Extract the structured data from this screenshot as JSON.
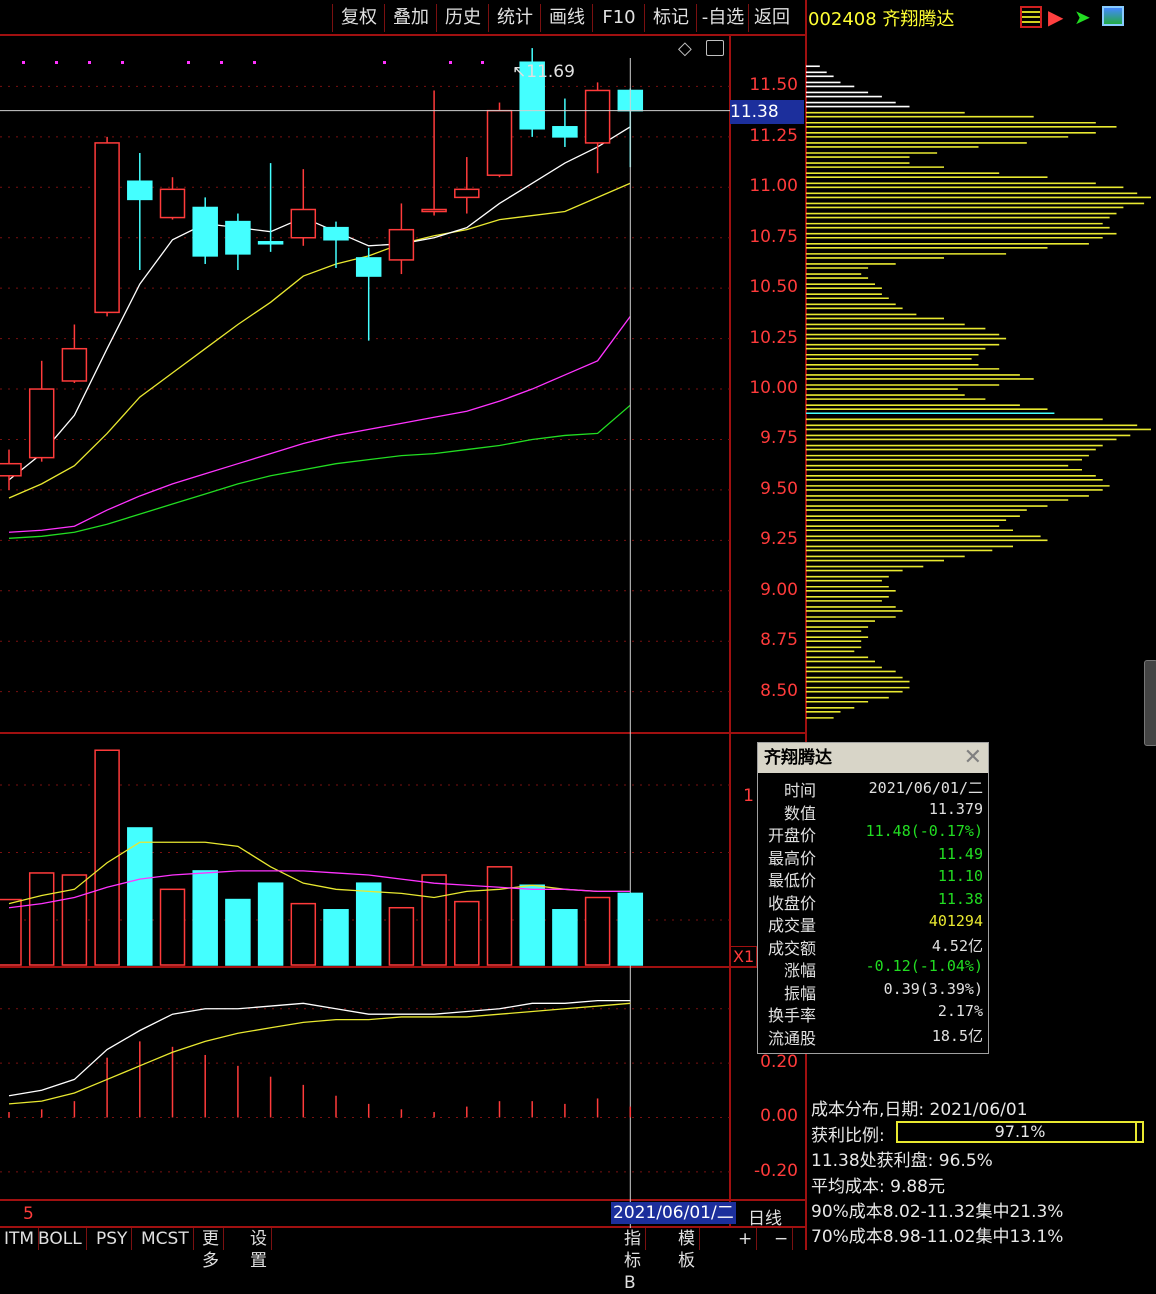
{
  "toolbar": {
    "buttons": [
      {
        "label": "复权"
      },
      {
        "label": "叠加"
      },
      {
        "label": "历史"
      },
      {
        "label": "统计"
      },
      {
        "label": "画线"
      },
      {
        "label": "F10"
      },
      {
        "label": "标记"
      },
      {
        "label": "-自选"
      },
      {
        "label": "返回"
      }
    ]
  },
  "stock": {
    "code_name": "002408 齐翔腾达"
  },
  "price_axis": {
    "ticks": [
      "11.50",
      "11.25",
      "11.00",
      "10.75",
      "10.50",
      "10.25",
      "10.00",
      "9.75",
      "9.50",
      "9.25",
      "9.00",
      "8.75",
      "8.50"
    ],
    "current_price_badge": "11.38",
    "high_marker": "11.69"
  },
  "volume_axis": {
    "tick": "1",
    "multiplier": "X1"
  },
  "macd_axis": {
    "ticks": [
      "0.20",
      "0.00",
      "-0.20"
    ]
  },
  "popup": {
    "title": "齐翔腾达",
    "rows": [
      {
        "key": "时间",
        "value": "2021/06/01/二",
        "color": "#e0e0e0"
      },
      {
        "key": "数值",
        "value": "11.379",
        "color": "#e0e0e0"
      },
      {
        "key": "开盘价",
        "value": "11.48(-0.17%)",
        "color": "#22dd22"
      },
      {
        "key": "最高价",
        "value": "11.49",
        "color": "#22dd22"
      },
      {
        "key": "最低价",
        "value": "11.10",
        "color": "#22dd22"
      },
      {
        "key": "收盘价",
        "value": "11.38",
        "color": "#22dd22"
      },
      {
        "key": "成交量",
        "value": "401294",
        "color": "#e8e830"
      },
      {
        "key": "成交额",
        "value": "4.52亿",
        "color": "#e0e0e0"
      },
      {
        "key": "涨幅",
        "value": "-0.12(-1.04%)",
        "color": "#22dd22"
      },
      {
        "key": "振幅",
        "value": "0.39(3.39%)",
        "color": "#e0e0e0"
      },
      {
        "key": "换手率",
        "value": "2.17%",
        "color": "#e0e0e0"
      },
      {
        "key": "流通股",
        "value": "18.5亿",
        "color": "#e0e0e0"
      }
    ]
  },
  "cost": {
    "date_line": "成本分布,日期: 2021/06/01",
    "profit_label": "获利比例:",
    "profit_value": "97.1%",
    "profit_fraction": 0.971,
    "at_price_line": "11.38处获利盘: 96.5%",
    "avg_line": "平均成本: 9.88元",
    "p90_line": "90%成本8.02-11.32集中21.3%",
    "p70_line": "70%成本8.98-11.02集中13.1%"
  },
  "date_axis": {
    "left_mark": "5",
    "cursor_date": "2021/06/01/二",
    "period": "日线"
  },
  "bottom_tabs": [
    "ITM",
    "BOLL",
    "PSY",
    "MCST",
    "更多",
    "设置"
  ],
  "bottom_right": [
    "指标B",
    "模 板",
    "+",
    "−"
  ],
  "colors": {
    "up": "#ff3b3b",
    "down": "#44ffff",
    "ma5": "#ffffff",
    "ma10": "#e8e830",
    "ma20": "#ff33ff",
    "ma60": "#22dd22",
    "border": "#a01010"
  },
  "chart_data": {
    "type": "candlestick",
    "price_ylim": [
      8.3,
      11.75
    ],
    "candles": [
      {
        "o": 9.57,
        "h": 9.7,
        "l": 9.5,
        "c": 9.63
      },
      {
        "o": 9.66,
        "h": 10.14,
        "l": 9.64,
        "c": 10.0
      },
      {
        "o": 10.04,
        "h": 10.32,
        "l": 10.03,
        "c": 10.2
      },
      {
        "o": 10.38,
        "h": 11.25,
        "l": 10.36,
        "c": 11.22
      },
      {
        "o": 11.03,
        "h": 11.17,
        "l": 10.59,
        "c": 10.94
      },
      {
        "o": 10.85,
        "h": 11.05,
        "l": 10.84,
        "c": 10.99
      },
      {
        "o": 10.9,
        "h": 10.95,
        "l": 10.62,
        "c": 10.66
      },
      {
        "o": 10.83,
        "h": 10.87,
        "l": 10.59,
        "c": 10.67
      },
      {
        "o": 10.73,
        "h": 11.12,
        "l": 10.68,
        "c": 10.72
      },
      {
        "o": 10.75,
        "h": 11.09,
        "l": 10.71,
        "c": 10.89
      },
      {
        "o": 10.8,
        "h": 10.83,
        "l": 10.6,
        "c": 10.74
      },
      {
        "o": 10.65,
        "h": 10.7,
        "l": 10.24,
        "c": 10.56
      },
      {
        "o": 10.64,
        "h": 10.92,
        "l": 10.57,
        "c": 10.79
      },
      {
        "o": 10.88,
        "h": 11.48,
        "l": 10.86,
        "c": 10.89
      },
      {
        "o": 10.95,
        "h": 11.15,
        "l": 10.87,
        "c": 10.99
      },
      {
        "o": 11.06,
        "h": 11.42,
        "l": 11.05,
        "c": 11.38
      },
      {
        "o": 11.62,
        "h": 11.69,
        "l": 11.25,
        "c": 11.29
      },
      {
        "o": 11.3,
        "h": 11.44,
        "l": 11.2,
        "c": 11.25
      },
      {
        "o": 11.22,
        "h": 11.52,
        "l": 11.07,
        "c": 11.48
      },
      {
        "o": 11.48,
        "h": 11.49,
        "l": 11.1,
        "c": 11.38
      }
    ],
    "ma5": [
      9.55,
      9.68,
      9.87,
      10.2,
      10.52,
      10.74,
      10.82,
      10.8,
      10.78,
      10.85,
      10.78,
      10.71,
      10.72,
      10.75,
      10.8,
      10.92,
      11.02,
      11.12,
      11.2,
      11.3
    ],
    "ma10": [
      9.46,
      9.53,
      9.62,
      9.78,
      9.96,
      10.08,
      10.2,
      10.32,
      10.43,
      10.56,
      10.62,
      10.66,
      10.72,
      10.76,
      10.79,
      10.84,
      10.86,
      10.88,
      10.95,
      11.02
    ],
    "ma20": [
      9.29,
      9.3,
      9.32,
      9.4,
      9.47,
      9.53,
      9.58,
      9.63,
      9.68,
      9.73,
      9.77,
      9.8,
      9.83,
      9.86,
      9.89,
      9.94,
      10.0,
      10.07,
      10.14,
      10.36
    ],
    "ma60": [
      9.26,
      9.27,
      9.29,
      9.33,
      9.38,
      9.43,
      9.48,
      9.53,
      9.57,
      9.6,
      9.63,
      9.65,
      9.67,
      9.68,
      9.7,
      9.72,
      9.75,
      9.77,
      9.78,
      9.92
    ],
    "volume": [
      0.32,
      0.45,
      0.44,
      1.05,
      0.67,
      0.37,
      0.46,
      0.32,
      0.4,
      0.3,
      0.27,
      0.4,
      0.28,
      0.44,
      0.31,
      0.48,
      0.39,
      0.27,
      0.33,
      0.35
    ],
    "vol_ma1": [
      0.3,
      0.34,
      0.37,
      0.5,
      0.6,
      0.6,
      0.6,
      0.58,
      0.48,
      0.4,
      0.37,
      0.36,
      0.35,
      0.33,
      0.36,
      0.37,
      0.39,
      0.37,
      0.36,
      0.36
    ],
    "vol_ma2": [
      0.28,
      0.3,
      0.33,
      0.38,
      0.42,
      0.44,
      0.45,
      0.46,
      0.46,
      0.46,
      0.45,
      0.44,
      0.42,
      0.4,
      0.39,
      0.38,
      0.37,
      0.37,
      0.36,
      0.36
    ],
    "macd_ylim": [
      -0.3,
      0.55
    ],
    "macd_dif": [
      0.08,
      0.1,
      0.14,
      0.25,
      0.32,
      0.38,
      0.4,
      0.4,
      0.41,
      0.42,
      0.4,
      0.38,
      0.38,
      0.38,
      0.39,
      0.4,
      0.42,
      0.42,
      0.43,
      0.43
    ],
    "macd_dea": [
      0.05,
      0.06,
      0.09,
      0.14,
      0.19,
      0.24,
      0.28,
      0.31,
      0.33,
      0.35,
      0.36,
      0.36,
      0.37,
      0.37,
      0.37,
      0.38,
      0.39,
      0.4,
      0.41,
      0.42
    ],
    "macd_hist": [
      0.02,
      0.03,
      0.06,
      0.22,
      0.28,
      0.26,
      0.23,
      0.19,
      0.15,
      0.12,
      0.08,
      0.05,
      0.03,
      0.02,
      0.04,
      0.06,
      0.06,
      0.05,
      0.07,
      0.04
    ],
    "profile": [
      {
        "p": 11.6,
        "w": 0.04,
        "c": "#ffffff"
      },
      {
        "p": 11.57,
        "w": 0.06,
        "c": "#ffffff"
      },
      {
        "p": 11.55,
        "w": 0.08,
        "c": "#ffffff"
      },
      {
        "p": 11.52,
        "w": 0.1,
        "c": "#ffffff"
      },
      {
        "p": 11.5,
        "w": 0.14,
        "c": "#ffffff"
      },
      {
        "p": 11.47,
        "w": 0.18,
        "c": "#ffffff"
      },
      {
        "p": 11.45,
        "w": 0.22,
        "c": "#ffffff"
      },
      {
        "p": 11.42,
        "w": 0.26,
        "c": "#ffffff"
      },
      {
        "p": 11.4,
        "w": 0.3,
        "c": "#ffffff"
      },
      {
        "p": 11.37,
        "w": 0.46,
        "c": "#e8e830"
      },
      {
        "p": 11.35,
        "w": 0.66,
        "c": "#e8e830"
      },
      {
        "p": 11.32,
        "w": 0.84,
        "c": "#e8e830"
      },
      {
        "p": 11.3,
        "w": 0.9,
        "c": "#e8e830"
      },
      {
        "p": 11.27,
        "w": 0.84,
        "c": "#e8e830"
      },
      {
        "p": 11.25,
        "w": 0.76,
        "c": "#e8e830"
      },
      {
        "p": 11.22,
        "w": 0.64,
        "c": "#e8e830"
      },
      {
        "p": 11.2,
        "w": 0.5,
        "c": "#e8e830"
      },
      {
        "p": 11.17,
        "w": 0.38,
        "c": "#e8e830"
      },
      {
        "p": 11.15,
        "w": 0.3,
        "c": "#e8e830"
      },
      {
        "p": 11.12,
        "w": 0.3,
        "c": "#e8e830"
      },
      {
        "p": 11.1,
        "w": 0.4,
        "c": "#e8e830"
      },
      {
        "p": 11.07,
        "w": 0.56,
        "c": "#e8e830"
      },
      {
        "p": 11.05,
        "w": 0.7,
        "c": "#e8e830"
      },
      {
        "p": 11.02,
        "w": 0.84,
        "c": "#e8e830"
      },
      {
        "p": 11.0,
        "w": 0.92,
        "c": "#e8e830"
      },
      {
        "p": 10.97,
        "w": 0.96,
        "c": "#e8e830"
      },
      {
        "p": 10.95,
        "w": 1.0,
        "c": "#e8e830"
      },
      {
        "p": 10.92,
        "w": 0.98,
        "c": "#e8e830"
      },
      {
        "p": 10.9,
        "w": 0.92,
        "c": "#e8e830"
      },
      {
        "p": 10.87,
        "w": 0.9,
        "c": "#e8e830"
      },
      {
        "p": 10.85,
        "w": 0.88,
        "c": "#e8e830"
      },
      {
        "p": 10.82,
        "w": 0.86,
        "c": "#e8e830"
      },
      {
        "p": 10.8,
        "w": 0.88,
        "c": "#e8e830"
      },
      {
        "p": 10.77,
        "w": 0.9,
        "c": "#e8e830"
      },
      {
        "p": 10.75,
        "w": 0.86,
        "c": "#e8e830"
      },
      {
        "p": 10.72,
        "w": 0.82,
        "c": "#e8e830"
      },
      {
        "p": 10.7,
        "w": 0.7,
        "c": "#e8e830"
      },
      {
        "p": 10.67,
        "w": 0.58,
        "c": "#e8e830"
      },
      {
        "p": 10.65,
        "w": 0.4,
        "c": "#e8e830"
      },
      {
        "p": 10.62,
        "w": 0.26,
        "c": "#e8e830"
      },
      {
        "p": 10.6,
        "w": 0.18,
        "c": "#e8e830"
      },
      {
        "p": 10.57,
        "w": 0.16,
        "c": "#e8e830"
      },
      {
        "p": 10.55,
        "w": 0.18,
        "c": "#e8e830"
      },
      {
        "p": 10.52,
        "w": 0.2,
        "c": "#e8e830"
      },
      {
        "p": 10.5,
        "w": 0.22,
        "c": "#e8e830"
      },
      {
        "p": 10.47,
        "w": 0.22,
        "c": "#e8e830"
      },
      {
        "p": 10.45,
        "w": 0.24,
        "c": "#e8e830"
      },
      {
        "p": 10.42,
        "w": 0.26,
        "c": "#e8e830"
      },
      {
        "p": 10.4,
        "w": 0.28,
        "c": "#e8e830"
      },
      {
        "p": 10.37,
        "w": 0.32,
        "c": "#e8e830"
      },
      {
        "p": 10.35,
        "w": 0.4,
        "c": "#e8e830"
      },
      {
        "p": 10.32,
        "w": 0.46,
        "c": "#e8e830"
      },
      {
        "p": 10.3,
        "w": 0.52,
        "c": "#e8e830"
      },
      {
        "p": 10.27,
        "w": 0.56,
        "c": "#e8e830"
      },
      {
        "p": 10.25,
        "w": 0.58,
        "c": "#e8e830"
      },
      {
        "p": 10.22,
        "w": 0.56,
        "c": "#e8e830"
      },
      {
        "p": 10.2,
        "w": 0.52,
        "c": "#e8e830"
      },
      {
        "p": 10.17,
        "w": 0.5,
        "c": "#e8e830"
      },
      {
        "p": 10.15,
        "w": 0.48,
        "c": "#e8e830"
      },
      {
        "p": 10.12,
        "w": 0.5,
        "c": "#e8e830"
      },
      {
        "p": 10.1,
        "w": 0.56,
        "c": "#e8e830"
      },
      {
        "p": 10.07,
        "w": 0.62,
        "c": "#e8e830"
      },
      {
        "p": 10.05,
        "w": 0.66,
        "c": "#e8e830"
      },
      {
        "p": 10.02,
        "w": 0.56,
        "c": "#e8e830"
      },
      {
        "p": 10.0,
        "w": 0.44,
        "c": "#e8e830"
      },
      {
        "p": 9.97,
        "w": 0.46,
        "c": "#e8e830"
      },
      {
        "p": 9.95,
        "w": 0.52,
        "c": "#e8e830"
      },
      {
        "p": 9.92,
        "w": 0.62,
        "c": "#e8e830"
      },
      {
        "p": 9.9,
        "w": 0.7,
        "c": "#e8e830"
      },
      {
        "p": 9.88,
        "w": 0.72,
        "c": "#44ffff"
      },
      {
        "p": 9.85,
        "w": 0.86,
        "c": "#e8e830"
      },
      {
        "p": 9.82,
        "w": 0.96,
        "c": "#e8e830"
      },
      {
        "p": 9.8,
        "w": 1.0,
        "c": "#e8e830"
      },
      {
        "p": 9.77,
        "w": 0.94,
        "c": "#e8e830"
      },
      {
        "p": 9.75,
        "w": 0.9,
        "c": "#e8e830"
      },
      {
        "p": 9.72,
        "w": 0.86,
        "c": "#e8e830"
      },
      {
        "p": 9.7,
        "w": 0.84,
        "c": "#e8e830"
      },
      {
        "p": 9.67,
        "w": 0.82,
        "c": "#e8e830"
      },
      {
        "p": 9.65,
        "w": 0.8,
        "c": "#e8e830"
      },
      {
        "p": 9.62,
        "w": 0.76,
        "c": "#e8e830"
      },
      {
        "p": 9.6,
        "w": 0.8,
        "c": "#e8e830"
      },
      {
        "p": 9.57,
        "w": 0.84,
        "c": "#e8e830"
      },
      {
        "p": 9.55,
        "w": 0.86,
        "c": "#e8e830"
      },
      {
        "p": 9.52,
        "w": 0.88,
        "c": "#e8e830"
      },
      {
        "p": 9.5,
        "w": 0.86,
        "c": "#e8e830"
      },
      {
        "p": 9.47,
        "w": 0.82,
        "c": "#e8e830"
      },
      {
        "p": 9.45,
        "w": 0.76,
        "c": "#e8e830"
      },
      {
        "p": 9.42,
        "w": 0.7,
        "c": "#e8e830"
      },
      {
        "p": 9.4,
        "w": 0.64,
        "c": "#e8e830"
      },
      {
        "p": 9.37,
        "w": 0.62,
        "c": "#e8e830"
      },
      {
        "p": 9.35,
        "w": 0.58,
        "c": "#e8e830"
      },
      {
        "p": 9.32,
        "w": 0.56,
        "c": "#e8e830"
      },
      {
        "p": 9.3,
        "w": 0.6,
        "c": "#e8e830"
      },
      {
        "p": 9.27,
        "w": 0.68,
        "c": "#e8e830"
      },
      {
        "p": 9.25,
        "w": 0.7,
        "c": "#e8e830"
      },
      {
        "p": 9.22,
        "w": 0.6,
        "c": "#e8e830"
      },
      {
        "p": 9.2,
        "w": 0.54,
        "c": "#e8e830"
      },
      {
        "p": 9.17,
        "w": 0.46,
        "c": "#e8e830"
      },
      {
        "p": 9.15,
        "w": 0.4,
        "c": "#e8e830"
      },
      {
        "p": 9.12,
        "w": 0.34,
        "c": "#e8e830"
      },
      {
        "p": 9.1,
        "w": 0.28,
        "c": "#e8e830"
      },
      {
        "p": 9.07,
        "w": 0.24,
        "c": "#e8e830"
      },
      {
        "p": 9.05,
        "w": 0.22,
        "c": "#e8e830"
      },
      {
        "p": 9.02,
        "w": 0.24,
        "c": "#e8e830"
      },
      {
        "p": 9.0,
        "w": 0.26,
        "c": "#e8e830"
      },
      {
        "p": 8.97,
        "w": 0.24,
        "c": "#e8e830"
      },
      {
        "p": 8.95,
        "w": 0.22,
        "c": "#e8e830"
      },
      {
        "p": 8.92,
        "w": 0.26,
        "c": "#e8e830"
      },
      {
        "p": 8.9,
        "w": 0.28,
        "c": "#e8e830"
      },
      {
        "p": 8.87,
        "w": 0.26,
        "c": "#e8e830"
      },
      {
        "p": 8.85,
        "w": 0.2,
        "c": "#e8e830"
      },
      {
        "p": 8.82,
        "w": 0.18,
        "c": "#e8e830"
      },
      {
        "p": 8.8,
        "w": 0.16,
        "c": "#e8e830"
      },
      {
        "p": 8.77,
        "w": 0.18,
        "c": "#e8e830"
      },
      {
        "p": 8.75,
        "w": 0.16,
        "c": "#e8e830"
      },
      {
        "p": 8.72,
        "w": 0.16,
        "c": "#e8e830"
      },
      {
        "p": 8.7,
        "w": 0.14,
        "c": "#e8e830"
      },
      {
        "p": 8.67,
        "w": 0.18,
        "c": "#e8e830"
      },
      {
        "p": 8.65,
        "w": 0.2,
        "c": "#e8e830"
      },
      {
        "p": 8.62,
        "w": 0.22,
        "c": "#e8e830"
      },
      {
        "p": 8.6,
        "w": 0.26,
        "c": "#e8e830"
      },
      {
        "p": 8.57,
        "w": 0.28,
        "c": "#e8e830"
      },
      {
        "p": 8.55,
        "w": 0.3,
        "c": "#e8e830"
      },
      {
        "p": 8.52,
        "w": 0.3,
        "c": "#e8e830"
      },
      {
        "p": 8.5,
        "w": 0.28,
        "c": "#e8e830"
      },
      {
        "p": 8.47,
        "w": 0.24,
        "c": "#e8e830"
      },
      {
        "p": 8.45,
        "w": 0.18,
        "c": "#e8e830"
      },
      {
        "p": 8.42,
        "w": 0.14,
        "c": "#e8e830"
      },
      {
        "p": 8.4,
        "w": 0.1,
        "c": "#e8e830"
      },
      {
        "p": 8.37,
        "w": 0.08,
        "c": "#e8e830"
      }
    ]
  }
}
